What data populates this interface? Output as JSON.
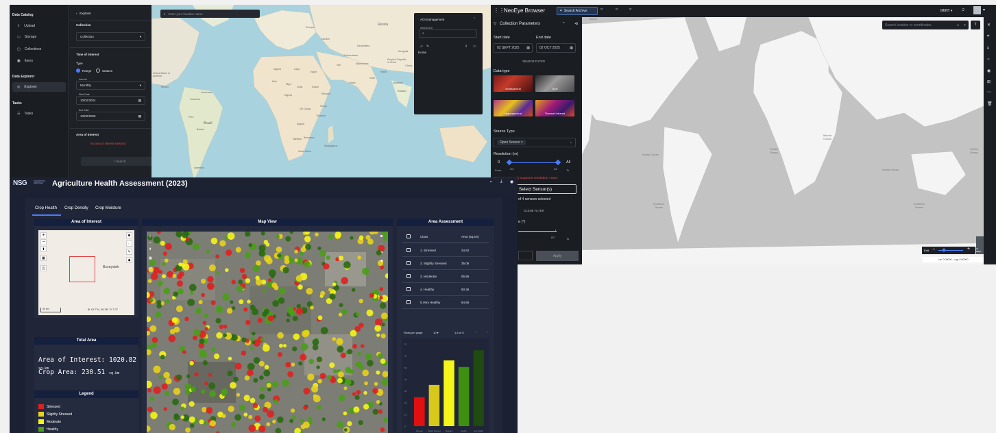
{
  "explorer": {
    "sidebar": {
      "data_catalog_title": "Data Catalog",
      "items": [
        "Upload",
        "Storage",
        "Collections",
        "Items"
      ],
      "data_explorer_title": "Data Explorer",
      "explorer_item": "Explorer",
      "tasks_title": "Tasks",
      "tasks_item": "Tasks"
    },
    "form": {
      "back_label": "Explorer",
      "collection_title": "Collection",
      "collection_value": "Collection",
      "toi_title": "Time of Interest",
      "type_label": "Type",
      "range_label": "Range",
      "season_label": "Season",
      "interval_label": "Interval",
      "interval_value": "Monthly",
      "start_label": "Start Date",
      "start_value": "10/02/2024",
      "end_label": "End Date",
      "end_value": "10/02/2025",
      "aoi_title": "Area of Interest",
      "aoi_error": "No area of interest selected",
      "search_button": "Search"
    },
    "map": {
      "search_placeholder": "Enter your location name",
      "labels": [
        "Europe",
        "Russia",
        "Kazakhstan",
        "Ukraine",
        "Turkmenistan",
        "Afghanistan",
        "Iran",
        "India",
        "Oman",
        "Libya",
        "Algeria",
        "Egypt",
        "Sudan",
        "Chad",
        "Niger",
        "Mali",
        "Nigeria",
        "Ethiopia",
        "Kenya",
        "Tanzania",
        "Angola",
        "Namibia",
        "Botswana",
        "South Africa",
        "Madagascar",
        "DR Congo",
        "Brazil",
        "Peru",
        "Bolivia",
        "Argentina",
        "Venezuela",
        "Colombia",
        "Greenland",
        "United States of America",
        "Mexico",
        "Mongolia",
        "China",
        "Nepal",
        "Myanmar",
        "Thailand",
        "People's Republic of China"
      ],
      "aoi_panel": {
        "title": "AOI management",
        "search_label": "Search AOI",
        "home_label": "Home"
      }
    }
  },
  "neoeye": {
    "topbar": {
      "title": "NeoEye Browser",
      "search_archive": "Search Archive",
      "user": "IMINT"
    },
    "panel": {
      "title": "Collection Parameters",
      "start_label": "Start date",
      "start_value": "02 SEPT 2025",
      "end_label": "End date",
      "end_value": "02 OCT 2025",
      "sensor_filter": "SENSOR FILTER",
      "data_type_label": "Data type",
      "thumbs": [
        "Multispectral",
        "SAR",
        "Hyperspectral",
        "Thermal Infrared"
      ],
      "source_type_label": "Source Type",
      "source_value": "Open Source",
      "resolution_label": "Resolution (m)",
      "res_min": "0",
      "res_max": "All",
      "res_from_label": "From",
      "res_from_unit": "0m",
      "res_all": "All",
      "res_to": "To",
      "warning": "Open source only supports resolution >10m.",
      "select_sensor": "Select Sensor(s)",
      "sensors_selected": "of 4 sensors selected",
      "scene_filter": "SCENE FILTER",
      "angle_label": "e (°)",
      "angle_max": "60°",
      "angle_to": "To",
      "apply": "Apply"
    },
    "map": {
      "search_placeholder": "Search location or coordinates",
      "oceans": [
        "Pacific Ocean",
        "Indian Ocean",
        "Atlantic Ocean",
        "Pacific Ocean",
        "Indian Ocean",
        "Southern Ocean",
        "Southern Ocean",
        "Ocean"
      ],
      "coords": "Lat: 0.00000 , Lng: 0.00000",
      "zoom_label": "Edit",
      "basemap_label": "Cr Maps"
    }
  },
  "agri": {
    "logo": "NSG",
    "logo_sub": "GEOSPATIAL SERVICES",
    "title": "Agriculture Health Assessment (2023)",
    "tabs": [
      "Crop Health",
      "Crop Density",
      "Crop Moisture"
    ],
    "aoi_card_title": "Area of Interest",
    "aoi_map_label": "Buraydah",
    "aoi_scale": "50 km",
    "aoi_coords": "⊕ 43.7°N, 26.36° ⊖ 7.07",
    "map_card_title": "Map View",
    "assess_title": "Area Assessment",
    "table": {
      "headers": [
        "Class",
        "Area (sq.km)"
      ],
      "rows": [
        {
          "cls": "1. Stressed",
          "area": "24.62"
        },
        {
          "cls": "2. Slightly Stressed",
          "area": "35.08"
        },
        {
          "cls": "3. Moderate",
          "area": "55.95"
        },
        {
          "cls": "4. Healthy",
          "area": "50.36"
        },
        {
          "cls": "5.Very Healthy",
          "area": "64.66"
        }
      ],
      "rows_per_page_label": "Rows per page:",
      "rows_per_page": "10",
      "pagination": "1-5 of 5"
    },
    "total_area_title": "Total Area",
    "aoi_area_label": "Area of Interest:",
    "aoi_area_value": "1020.82",
    "crop_area_label": "Crop Area:",
    "crop_area_value": "230.51",
    "unit": "sq.km",
    "legend_title": "Legend",
    "legend": [
      {
        "label": "Stressed",
        "color": "#e02020"
      },
      {
        "label": "Slightly Stressed",
        "color": "#e8d21a"
      },
      {
        "label": "Moderate",
        "color": "#f5f51a"
      },
      {
        "label": "Healthy",
        "color": "#4a9e1a"
      }
    ],
    "chart_data": {
      "type": "bar",
      "categories": [
        "Stressed",
        "Slightly Stressed",
        "Moderate",
        "Healthy",
        "Very Healthy"
      ],
      "values": [
        24.62,
        35.08,
        55.95,
        50.36,
        64.66
      ],
      "colors": [
        "#e01010",
        "#d8c81a",
        "#f5f51a",
        "#3f8f10",
        "#1f4a10"
      ],
      "ylim": [
        0,
        70
      ]
    }
  }
}
